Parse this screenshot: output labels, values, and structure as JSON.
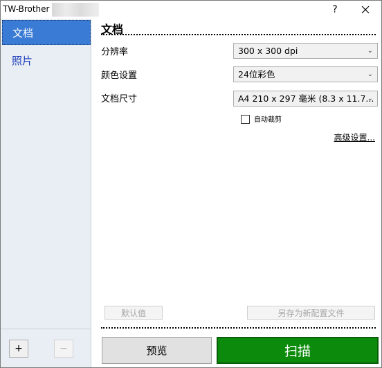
{
  "window": {
    "title": "TW-Brother",
    "help_label": "?",
    "close_label": "✕"
  },
  "sidebar": {
    "items": [
      {
        "label": "文档",
        "selected": true
      },
      {
        "label": "照片",
        "selected": false
      }
    ],
    "add_label": "+",
    "remove_label": "−"
  },
  "main": {
    "section_title": "文档",
    "resolution": {
      "label": "分辨率",
      "value": "300 x 300 dpi"
    },
    "color": {
      "label": "颜色设置",
      "value": "24位彩色"
    },
    "size": {
      "label": "文档尺寸",
      "value": "A4 210 x 297 毫米 (8.3 x 11.7..."
    },
    "auto_crop_label": "自动裁剪",
    "auto_crop_checked": false,
    "advanced_label": "高级设置...",
    "default_label": "默认值",
    "save_profile_label": "另存为新配置文件",
    "preview_label": "预览",
    "scan_label": "扫描"
  },
  "colors": {
    "selected_item": "#3a7bd5",
    "sidebar_bg": "#e9eef4",
    "scan_button": "#0b8a0b",
    "link_text": "#1a3ab8"
  }
}
